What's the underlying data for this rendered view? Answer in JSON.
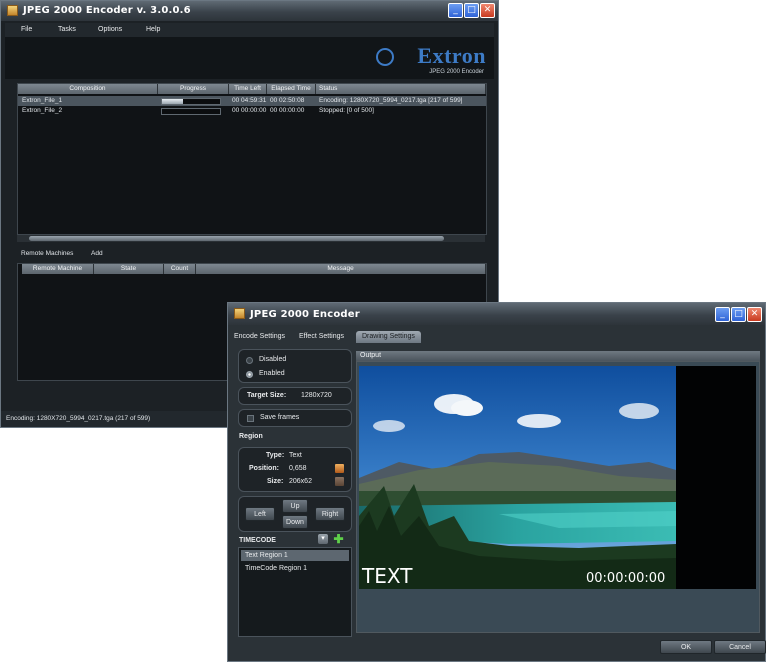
{
  "main_window": {
    "title": "JPEG 2000 Encoder  v. 3.0.0.6",
    "menu": [
      "File",
      "Tasks",
      "Options",
      "Help"
    ],
    "logo": {
      "name": "Extron",
      "subtitle": "JPEG 2000 Encoder"
    },
    "jobs": {
      "columns": [
        "Composition",
        "Progress",
        "Time Left",
        "Elapsed Time",
        "Status"
      ],
      "rows": [
        {
          "composition": "Extron_File_1",
          "progress": 0.36,
          "time_left": "00 04:59:31",
          "elapsed": "00 02:50:08",
          "status": "Encoding: 1280X720_5994_0217.tga [217 of 599]"
        },
        {
          "composition": "Extron_File_2",
          "progress": 0.0,
          "time_left": "00 00:00:00",
          "elapsed": "00 00:00:00",
          "status": "Stopped: [0 of 500]"
        }
      ]
    },
    "remote_tabs": [
      "Remote Machines",
      "Add"
    ],
    "remote": {
      "columns": [
        "Remote Machine",
        "State",
        "Count",
        "Message"
      ]
    },
    "status_text": "Encoding:  1280X720_5994_0217.tga (217 of 599)"
  },
  "encoder_window": {
    "title": "JPEG 2000 Encoder",
    "tabs": [
      "Encode Settings",
      "Effect Settings",
      "Drawing Settings"
    ],
    "active_tab": "Drawing Settings",
    "mode": {
      "disabled_label": "Disabled",
      "enabled_label": "Enabled",
      "selected": "Enabled"
    },
    "target_size": {
      "label": "Target Size:",
      "value": "1280x720"
    },
    "save_frames_label": "Save frames",
    "region": {
      "heading": "Region",
      "type_label": "Type:",
      "type_value": "Text",
      "position_label": "Position:",
      "position_value": "0,658",
      "size_label": "Size:",
      "size_value": "206x62"
    },
    "nav": {
      "up": "Up",
      "left": "Left",
      "down": "Down",
      "right": "Right"
    },
    "region_type_select": "TIMECODE",
    "regions": [
      "Text Region 1",
      "TimeCode Region 1"
    ],
    "selected_region": "Text Region 1",
    "output": {
      "header": "Output",
      "overlay_text": "TEXT",
      "overlay_timecode": "00:00:00:00"
    },
    "buttons": {
      "ok": "OK",
      "cancel": "Cancel"
    }
  },
  "colors": {
    "accent": "#3d7bc6",
    "window_bg": "#1c2125",
    "header": "#6f7982"
  }
}
